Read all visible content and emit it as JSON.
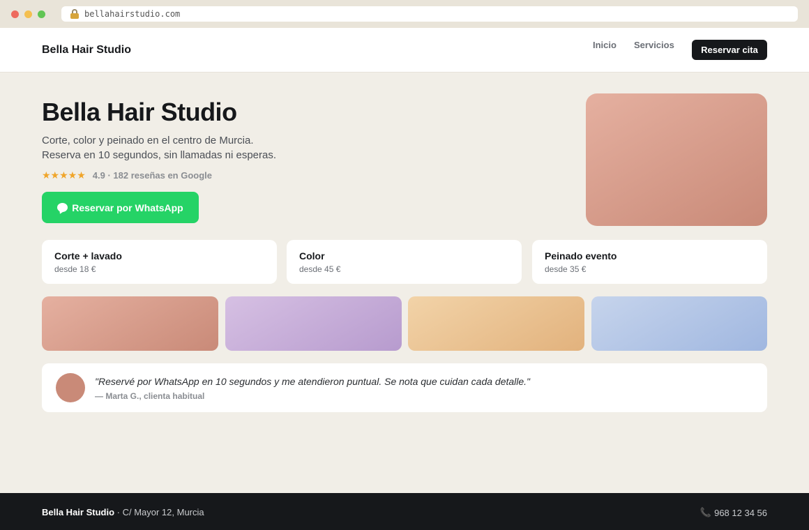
{
  "browser": {
    "url": "bellahairstudio.com"
  },
  "nav": {
    "brand": "Bella Hair Studio",
    "links": [
      "Inicio",
      "Servicios"
    ],
    "cta": "Reservar cita"
  },
  "hero": {
    "title": "Bella Hair Studio",
    "subtitle_line1": "Corte, color y peinado en el centro de Murcia.",
    "subtitle_line2": "Reserva en 10 segundos, sin llamadas ni esperas.",
    "stars": "★★★★★",
    "rating_text": "4.9 · 182 reseñas en Google",
    "whatsapp_button": "Reservar por WhatsApp"
  },
  "services": [
    {
      "name": "Corte + lavado",
      "price": "desde 18 €"
    },
    {
      "name": "Color",
      "price": "desde 45 €"
    },
    {
      "name": "Peinado evento",
      "price": "desde 35 €"
    }
  ],
  "testimonial": {
    "quote": "\"Reservé por WhatsApp en 10 segundos y me atendieron puntual. Se nota que cuidan cada detalle.\"",
    "author": "— Marta G., clienta habitual"
  },
  "footer": {
    "brand": "Bella Hair Studio",
    "address": " · C/ Mayor 12, Murcia",
    "phone": "968 12 34 56"
  },
  "colors": {
    "background": "#f1eee7",
    "dark": "#16181b",
    "whatsapp": "#25d366",
    "stars": "#f0a52a"
  }
}
